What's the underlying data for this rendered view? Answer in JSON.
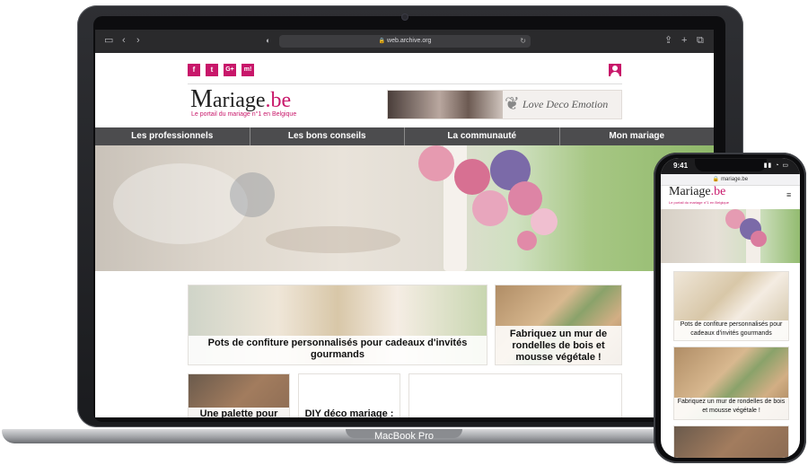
{
  "browser": {
    "url": "web.archive.org"
  },
  "site": {
    "social": [
      {
        "icon": "facebook-icon",
        "glyph": "f"
      },
      {
        "icon": "twitter-icon",
        "glyph": "t"
      },
      {
        "icon": "google-plus-icon",
        "glyph": "G+"
      },
      {
        "icon": "mariage-icon",
        "glyph": "m!"
      }
    ],
    "logo_initial": "M",
    "logo_rest": "ariage",
    "logo_tld": ".be",
    "tagline": "Le portail du mariage n°1 en Belgique",
    "ad_brand": "Love Deco Emotion",
    "nav": [
      "Les professionnels",
      "Les bons conseils",
      "La communauté",
      "Mon mariage"
    ],
    "cards": [
      {
        "title": "Pots de confiture personnalisés pour cadeaux d'invités gourmands"
      },
      {
        "title": "Fabriquez un mur de rondelles de bois et mousse végétale !"
      },
      {
        "title": "Une palette pour"
      },
      {
        "title": "DIY déco mariage :"
      }
    ]
  },
  "device_label": "MacBook Pro",
  "phone": {
    "time": "9:41",
    "url": "mariage.be",
    "cards": [
      {
        "title": "Pots de confiture personnalisés pour cadeaux d'invités gourmands"
      },
      {
        "title": "Fabriquez un mur de rondelles de bois et mousse végétale !"
      }
    ]
  },
  "colors": {
    "brand": "#c8176a",
    "nav_bg": "#4c4c4e"
  }
}
